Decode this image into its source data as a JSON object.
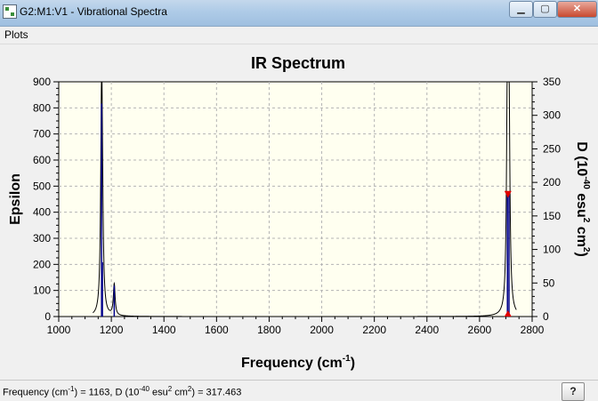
{
  "window": {
    "title": "G2:M1:V1 - Vibrational Spectra",
    "minimize_label": "▁",
    "maximize_label": "▢",
    "close_label": "✕"
  },
  "menu": {
    "items": [
      {
        "label": "Plots"
      }
    ]
  },
  "status": {
    "freq_label": "Frequency (cm",
    "freq_sup": "-1",
    "freq_mid": ") = 1163, D (10",
    "d_sup": "-40",
    "d_mid": " esu",
    "esu_sup": "2",
    "d_mid2": " cm",
    "cm_sup": "2",
    "d_end": ") = 317.463",
    "help_label": "?"
  },
  "colors": {
    "plot_bg": "#fffff0",
    "spectrum_line": "#000000",
    "stick": "#00008b",
    "marker": "#e00000"
  },
  "chart_data": {
    "type": "line",
    "title": "IR Spectrum",
    "xlabel": "Frequency (cm",
    "xlabel_sup": "-1",
    "xlabel_end": ")",
    "ylabel": "Epsilon",
    "y2label_pre": "D (10",
    "y2label_sup1": "-40",
    "y2label_mid": " esu",
    "y2label_sup2": "2",
    "y2label_mid2": " cm",
    "y2label_sup3": "2",
    "y2label_end": ")",
    "xlim": [
      1000,
      2800
    ],
    "ylim": [
      0,
      900
    ],
    "y2lim": [
      0,
      350
    ],
    "xticks": [
      1000,
      1200,
      1400,
      1600,
      1800,
      2000,
      2200,
      2400,
      2600,
      2800
    ],
    "yticks": [
      0,
      100,
      200,
      300,
      400,
      500,
      600,
      700,
      800,
      900
    ],
    "y2ticks": [
      0,
      50,
      100,
      150,
      200,
      250,
      300,
      350
    ],
    "grid": true,
    "linewidth": 4,
    "peaks": [
      {
        "x": 1163,
        "epsilon": 815,
        "d": 317.463
      },
      {
        "x": 1166,
        "epsilon": 210,
        "d": 81
      },
      {
        "x": 1211,
        "epsilon": 120,
        "d": 46
      },
      {
        "x": 2706,
        "epsilon": 825,
        "d": 185
      },
      {
        "x": 2712,
        "epsilon": 730,
        "d": 182
      }
    ],
    "marker": {
      "x": 2708,
      "d": 182
    }
  }
}
